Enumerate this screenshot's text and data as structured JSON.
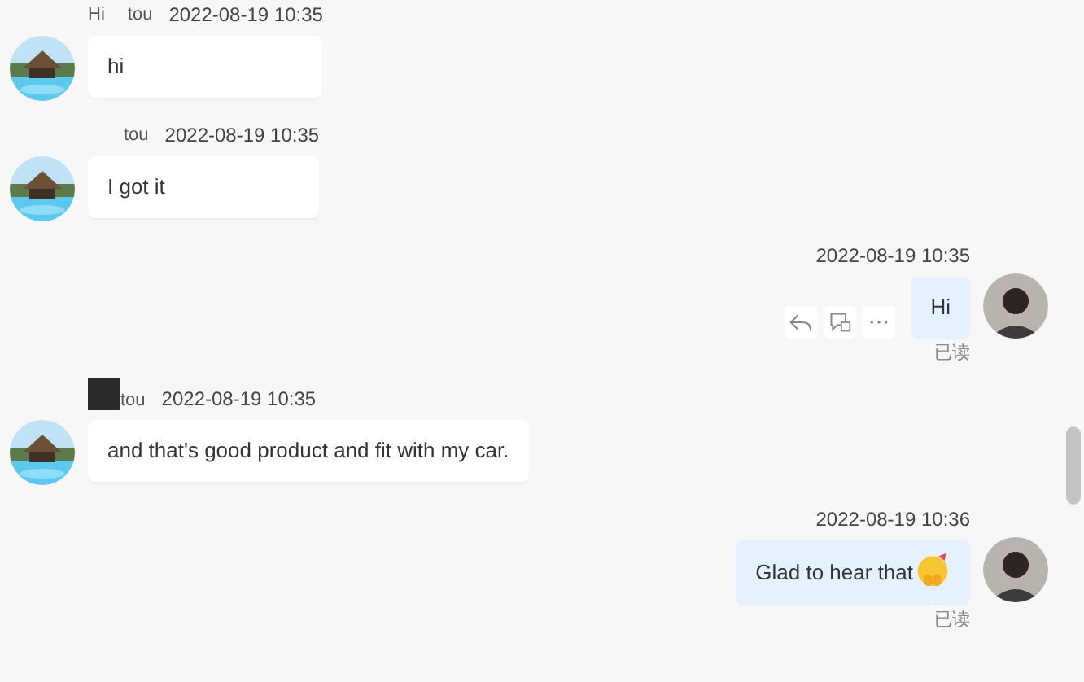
{
  "messages": [
    {
      "kind": "incoming",
      "sender_parts": [
        "Hi",
        "tou"
      ],
      "time": "2022-08-19 10:35",
      "text": "hi"
    },
    {
      "kind": "incoming",
      "sender_parts": [
        "tou"
      ],
      "time": "2022-08-19 10:35",
      "text": "I got it"
    },
    {
      "kind": "outgoing",
      "time": "2022-08-19 10:35",
      "text": "Hi",
      "actions": true,
      "read": "已读"
    },
    {
      "kind": "incoming",
      "sender_parts": [
        "tou"
      ],
      "redacted": true,
      "time": "2022-08-19 10:35",
      "text": "and that's good product and fit with my car."
    },
    {
      "kind": "outgoing",
      "time": "2022-08-19 10:36",
      "text": "Glad to hear that",
      "emoji": true,
      "read": "已读"
    }
  ]
}
